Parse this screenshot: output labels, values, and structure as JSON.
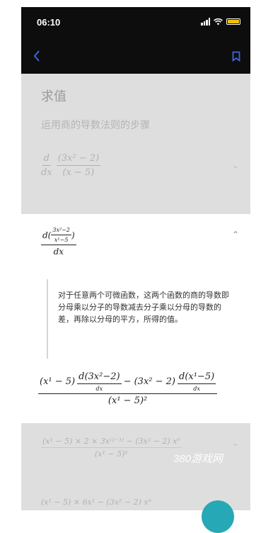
{
  "status": {
    "time": "06:10"
  },
  "nav": {
    "back_icon": "chevron-left-icon",
    "bookmark_icon": "bookmark-icon",
    "accent": "#3b66e0"
  },
  "page": {
    "title": "求值",
    "subtitle": "运用商的导数法则的步骤"
  },
  "step1": {
    "d": "d",
    "dx": "dx",
    "num": "(3x² − 2)",
    "den": "(x − 5)"
  },
  "card": {
    "head_num": "d(",
    "head_inner_num": "3x²−2",
    "head_inner_den": "x¹−5",
    "head_close": ")",
    "head_den": "dx",
    "note": "对于任意两个可微函数，这两个函数的商的导数即分母乘以分子的导数减去分子乘以分母的导数的差，再除以分母的平方，所得的值。",
    "formula_a": "(x¹ − 5)",
    "formula_b": "d(3x²−2)",
    "formula_c": " − (3x² − 2) ",
    "formula_d": "d(x¹−5)",
    "formula_dx": "dx",
    "formula_den": "(x¹ − 5)²"
  },
  "step3": {
    "num": "(x¹ − 5) × 2 × 3x⁽²⁻¹⁾ − (3x² − 2) x⁰",
    "den": "(x¹ − 5)²"
  },
  "step4": {
    "num": "(x¹ − 5) × 6x¹ − (3x² − 2) x⁰"
  },
  "watermark": "380游戏网"
}
